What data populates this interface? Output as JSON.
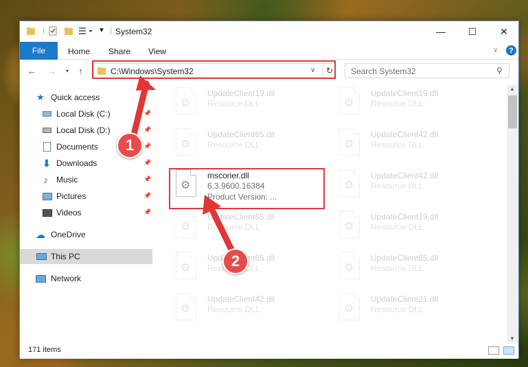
{
  "window": {
    "title": "System32"
  },
  "window_controls": {
    "minimize": "—",
    "maximize": "☐",
    "close": "✕"
  },
  "ribbon": {
    "tabs": [
      "File",
      "Home",
      "Share",
      "View"
    ]
  },
  "address": {
    "path": "C:\\Windows\\System32"
  },
  "search": {
    "placeholder": "Search System32"
  },
  "sidebar": {
    "items": [
      {
        "label": "Quick access",
        "icon": "star-icon"
      },
      {
        "label": "Local Disk (C:)",
        "icon": "drive-icon"
      },
      {
        "label": "Local Disk (D:)",
        "icon": "drive-icon"
      },
      {
        "label": "Documents",
        "icon": "documents-icon"
      },
      {
        "label": "Downloads",
        "icon": "downloads-icon"
      },
      {
        "label": "Music",
        "icon": "music-icon"
      },
      {
        "label": "Pictures",
        "icon": "pictures-icon"
      },
      {
        "label": "Videos",
        "icon": "videos-icon"
      },
      {
        "label": "OneDrive",
        "icon": "cloud-icon"
      },
      {
        "label": "This PC",
        "icon": "computer-icon"
      },
      {
        "label": "Network",
        "icon": "network-icon"
      }
    ]
  },
  "files": {
    "left": [
      {
        "name": "UpdateClient19.dll",
        "sub": "Resource DLL"
      },
      {
        "name": "UpdateClient65.dll",
        "sub": "Resource DLL"
      },
      {
        "name": "mscorier.dll",
        "sub": "6.3.9600.16384",
        "sub2": "Product Version:     ..."
      },
      {
        "name": "UpdateClient65.dll",
        "sub": "Resource DLL"
      },
      {
        "name": "UpdateClient65.dll",
        "sub": "Resource DLL"
      },
      {
        "name": "UpdateClient42.dll",
        "sub": "Resource DLL"
      }
    ],
    "right": [
      {
        "name": "UpdateClient19.dll",
        "sub": "Resource DLL"
      },
      {
        "name": "UpdateClient42.dll",
        "sub": "Resource DLL"
      },
      {
        "name": "UpdateClient42.dll",
        "sub": "Resource DLL"
      },
      {
        "name": "UpdateClient19.dll",
        "sub": "Resource DLL"
      },
      {
        "name": "UpdateClient65.dll",
        "sub": "Resource DLL"
      },
      {
        "name": "UpdateClient21.dll",
        "sub": "Resource DLL"
      }
    ]
  },
  "status": {
    "count": "171 items"
  },
  "annotations": {
    "marker1": "1",
    "marker2": "2",
    "color": "#e03636"
  }
}
